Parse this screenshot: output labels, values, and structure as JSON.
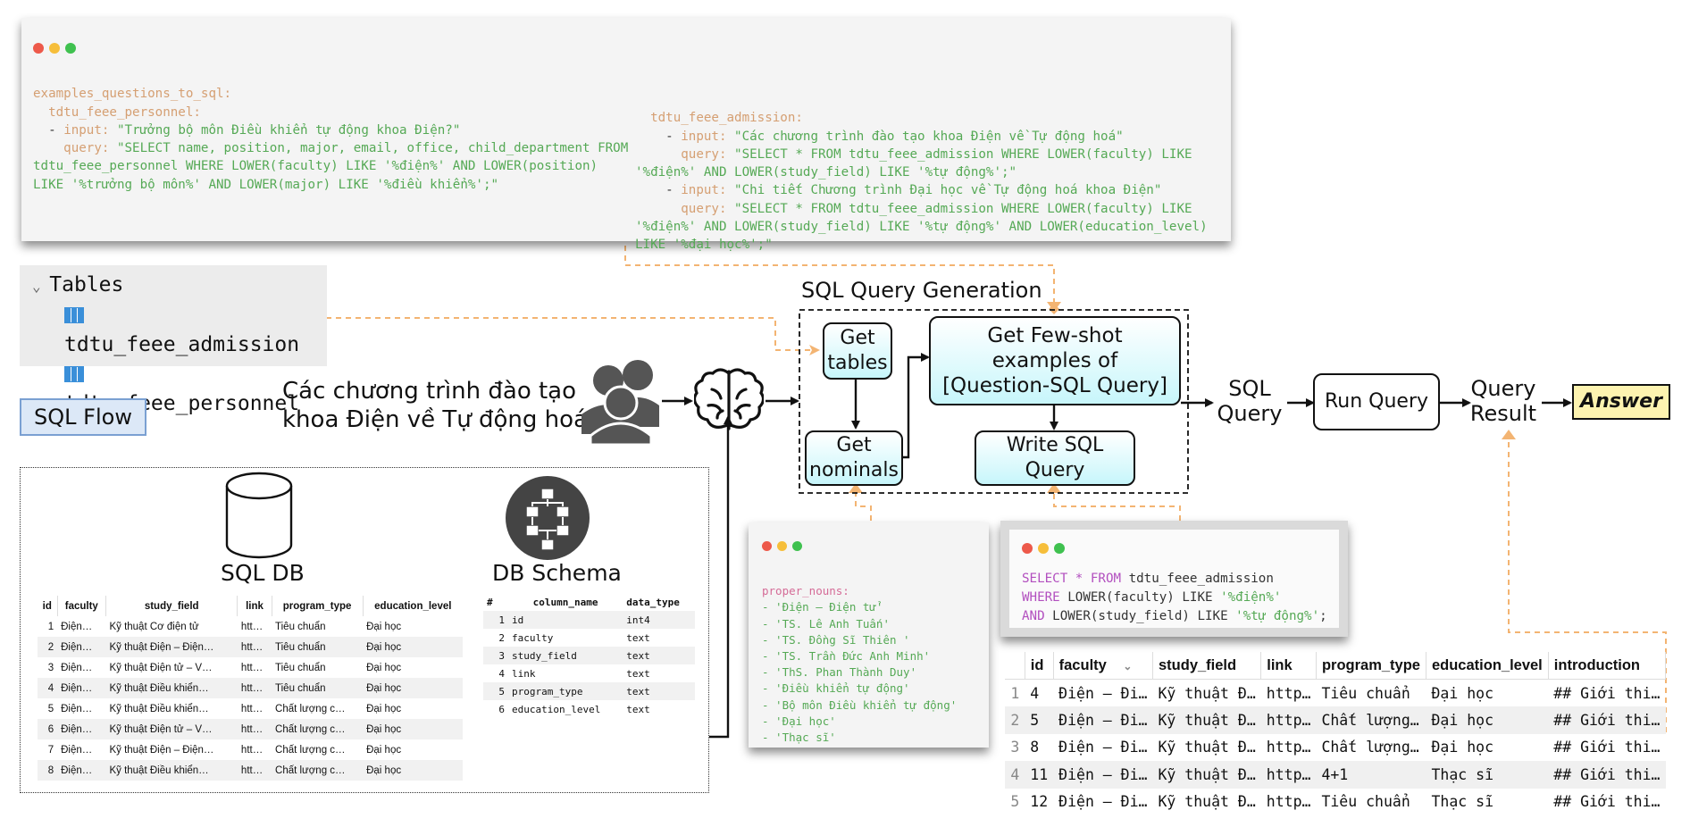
{
  "code_top": {
    "line1": "examples_questions_to_sql:",
    "personnel_key": "tdtu_feee_personnel:",
    "personnel_input": "\"Trưởng bộ môn Điều khiển tự động khoa Điện?\"",
    "personnel_query_1": "\"SELECT name, position, major, email, office, child_department FROM",
    "personnel_query_2": "tdtu_feee_personnel WHERE LOWER(faculty) LIKE '%điện%' AND LOWER(position)",
    "personnel_query_3": "LIKE '%trưởng bộ môn%' AND LOWER(major) LIKE '%điều khiển%';\"",
    "admission_key": "tdtu_feee_admission:",
    "adm_input_1": "\"Các chương trình đào tạo khoa Điện về Tự động hoá\"",
    "adm_query_1a": "\"SELECT * FROM tdtu_feee_admission WHERE LOWER(faculty) LIKE",
    "adm_query_1b": "'%điện%' AND LOWER(study_field) LIKE '%tự động%';\"",
    "adm_input_2": "\"Chi tiết Chương trình Đại học về Tự động hoá khoa Điện\"",
    "adm_query_2a": "\"SELECT * FROM tdtu_feee_admission WHERE LOWER(faculty) LIKE",
    "adm_query_2b": "'%điện%' AND LOWER(study_field) LIKE '%tự động%' AND LOWER(education_level)",
    "adm_query_2c": "LIKE '%đại học%';\"",
    "input_kw": "- input:",
    "query_kw": "query:"
  },
  "tables_panel": {
    "header": "Tables",
    "items": [
      "tdtu_feee_admission",
      "tdtu_feee_personnel"
    ]
  },
  "sql_flow_label": "SQL Flow",
  "question_line1": "Các chương trình đào tạo",
  "question_line2": "khoa Điện về Tự động hoá",
  "generation_title": "SQL Query Generation",
  "boxes": {
    "get_tables": "Get tables",
    "few_shot": "Get Few-shot examples of [Question-SQL Query]",
    "get_nominals": "Get nominals",
    "write_sql": "Write SQL Query",
    "sql_query": "SQL Query",
    "run_query": "Run Query",
    "query_result": "Query Result",
    "answer": "Answer"
  },
  "sql_db_label": "SQL DB",
  "db_schema_label": "DB Schema",
  "db_table": {
    "headers": [
      "id",
      "faculty",
      "study_field",
      "link",
      "program_type",
      "education_level"
    ],
    "rows": [
      [
        "1",
        "Điện…",
        "Kỹ thuật Cơ điện tử",
        "htt…",
        "Tiêu chuẩn",
        "Đại học"
      ],
      [
        "2",
        "Điện…",
        "Kỹ thuật Điện – Điện…",
        "htt…",
        "Tiêu chuẩn",
        "Đại học"
      ],
      [
        "3",
        "Điện…",
        "Kỹ thuật Điện tử – V…",
        "htt…",
        "Tiêu chuẩn",
        "Đại học"
      ],
      [
        "4",
        "Điện…",
        "Kỹ thuật Điều khiển…",
        "htt…",
        "Tiêu chuẩn",
        "Đại học"
      ],
      [
        "5",
        "Điện…",
        "Kỹ thuật Điều khiển…",
        "htt…",
        "Chất lượng c…",
        "Đại học"
      ],
      [
        "6",
        "Điện…",
        "Kỹ thuật Điện tử – V…",
        "htt…",
        "Chất lượng c…",
        "Đại học"
      ],
      [
        "7",
        "Điện…",
        "Kỹ thuật Điện – Điện…",
        "htt…",
        "Chất lượng c…",
        "Đại học"
      ],
      [
        "8",
        "Điện…",
        "Kỹ thuật Điều khiển…",
        "htt…",
        "Chất lượng c…",
        "Đại học"
      ]
    ]
  },
  "schema_table": {
    "headers": [
      "#",
      "column_name",
      "data_type"
    ],
    "rows": [
      [
        "1",
        "id",
        "int4"
      ],
      [
        "2",
        "faculty",
        "text"
      ],
      [
        "3",
        "study_field",
        "text"
      ],
      [
        "4",
        "link",
        "text"
      ],
      [
        "5",
        "program_type",
        "text"
      ],
      [
        "6",
        "education_level",
        "text"
      ]
    ]
  },
  "proper_nouns": {
    "key": "proper_nouns:",
    "items": [
      "- 'Điện – Điện tử'",
      "- 'TS. Lê Anh Tuấn'",
      "- 'TS. Đồng Sĩ Thiên '",
      "- 'TS. Trần Đức Anh Minh'",
      "- 'ThS. Phan Thành Duy'",
      "- 'Điều khiển tự động'",
      "- 'Bộ môn Điều khiển tự động'",
      "- 'Đại học'",
      "- 'Thạc sĩ'"
    ]
  },
  "sql_code": {
    "l1_kw": "SELECT",
    "l1_op": " * ",
    "l1_kw2": "FROM",
    "l1_rest": " tdtu_feee_admission",
    "l2_kw": "WHERE",
    "l2_rest": " LOWER(faculty) LIKE ",
    "l2_str": "'%điện%'",
    "l3_kw": "AND",
    "l3_rest": " LOWER(study_field) LIKE ",
    "l3_str": "'%tự động%'",
    "l3_end": ";"
  },
  "result_table": {
    "headers": [
      "id",
      "faculty",
      "study_field",
      "link",
      "program_type",
      "education_level",
      "introduction"
    ],
    "rows": [
      [
        "1",
        "4",
        "Điện – Đi…",
        "Kỹ thuật Đ…",
        "http…",
        "Tiêu chuẩn",
        "Đại học",
        "## Giới thi…"
      ],
      [
        "2",
        "5",
        "Điện – Đi…",
        "Kỹ thuật Đ…",
        "http…",
        "Chất lượng…",
        "Đại học",
        "## Giới thi…"
      ],
      [
        "3",
        "8",
        "Điện – Đi…",
        "Kỹ thuật Đ…",
        "http…",
        "Chất lượng…",
        "Đại học",
        "## Giới thi…"
      ],
      [
        "4",
        "11",
        "Điện – Đi…",
        "Kỹ thuật Đ…",
        "http…",
        "4+1",
        "Thạc sĩ",
        "## Giới thi…"
      ],
      [
        "5",
        "12",
        "Điện – Đi…",
        "Kỹ thuật Đ…",
        "http…",
        "Tiêu chuẩn",
        "Thạc sĩ",
        "## Giới thi…"
      ]
    ]
  }
}
